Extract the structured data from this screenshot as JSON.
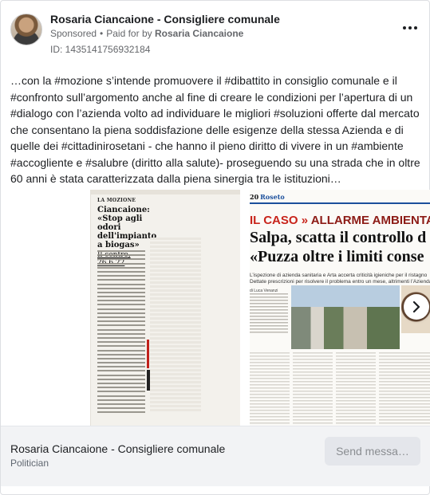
{
  "header": {
    "author": "Rosaria Ciancaione - Consigliere comunale",
    "sponsored": "Sponsored",
    "separator": "•",
    "paid_for_prefix": "Paid for by",
    "paid_for_by": "Rosaria Ciancaione",
    "id_text": "ID: 1435141756932184",
    "more_icon": "more-horizontal-icon"
  },
  "post": {
    "text": "…con la #mozione s’intende promuovere il #dibattito in consiglio comunale e il #confronto sull’argomento anche al fine di creare le condizioni per l’apertura di un #dialogo con l’azienda volto ad individuare le migliori #soluzioni offerte dal mercato che consentano la piena soddisfazione delle esigenze della stessa Azienda e di quelle dei #cittadinirosetani - che hanno il pieno diritto di vivere in un #ambiente #accogliente e #salubre (diritto alla salute)- proseguendo su una strada che in oltre 60 anni è stata caratterizzata dalla piena sinergia tra le istituzioni…"
  },
  "media": {
    "clip1": {
      "kicker": "LA MOZIONE",
      "headline": "Ciancaione: «Stop agli odori dell'impianto a biogas»",
      "source": "Il centro, 26.6.22"
    },
    "clip2": {
      "page_number": "20",
      "city": "Roseto",
      "section_red": "IL CASO",
      "section_sep": "»",
      "section_rest": "ALLARME AMBIENTALE",
      "headline_line1": "Salpa, scatta il controllo d",
      "headline_line2": "«Puzza oltre i limiti conse",
      "deck_line1": "L’ispezione di azienda sanitaria e Arta accerta criticità igieniche per il ristagno",
      "deck_line2": "Dettate prescrizioni per risolvere il problema entro un mese, altrimenti l’Azienda",
      "byline": "di Luca Venanzi"
    },
    "next_icon": "chevron-right-icon"
  },
  "footer": {
    "page_name": "Rosaria Ciancaione - Consigliere comunale",
    "category": "Politician",
    "send_button": "Send messa…"
  }
}
